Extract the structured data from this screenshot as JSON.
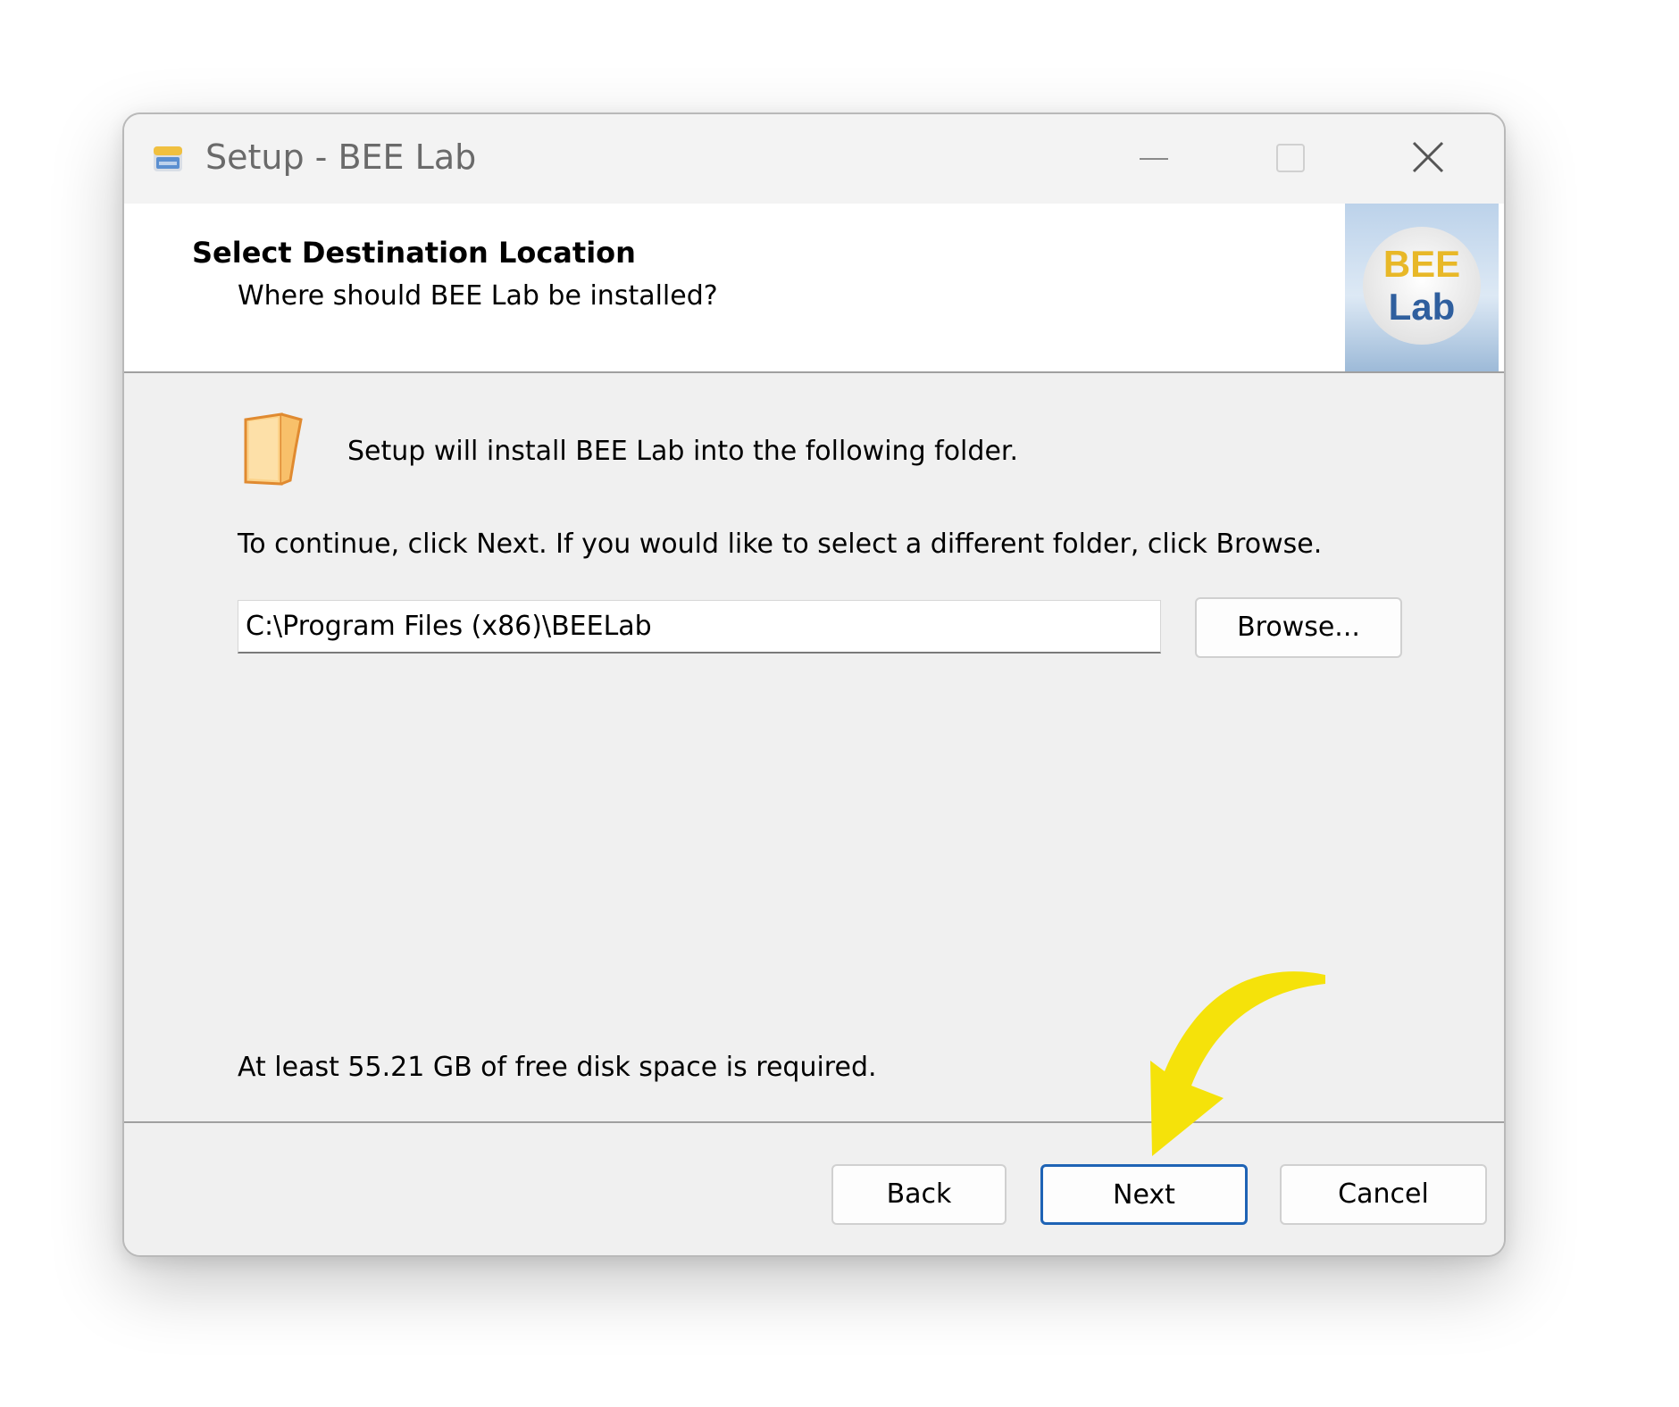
{
  "window": {
    "title": "Setup - BEE Lab"
  },
  "header": {
    "title": "Select Destination Location",
    "subtitle": "Where should BEE Lab be installed?",
    "logo_line1": "BEE",
    "logo_line2": "Lab"
  },
  "body": {
    "intro": "Setup will install BEE Lab into the following folder.",
    "instruction": "To continue, click Next. If you would like to select a different folder, click Browse.",
    "install_path": "C:\\Program Files (x86)\\BEELab",
    "browse_label": "Browse...",
    "disk_space": "At least 55.21 GB of free disk space is required."
  },
  "footer": {
    "back_label": "Back",
    "next_label": "Next",
    "cancel_label": "Cancel"
  },
  "colors": {
    "accent": "#1e63b5",
    "annotation_arrow": "#f5e20a",
    "logo_text_top": "#e8b828",
    "logo_text_bottom": "#2f5f9e"
  },
  "icons": [
    "app-icon",
    "minimize-icon",
    "maximize-icon",
    "close-icon",
    "folder-icon",
    "bee-lab-logo",
    "annotation-arrow-icon"
  ]
}
